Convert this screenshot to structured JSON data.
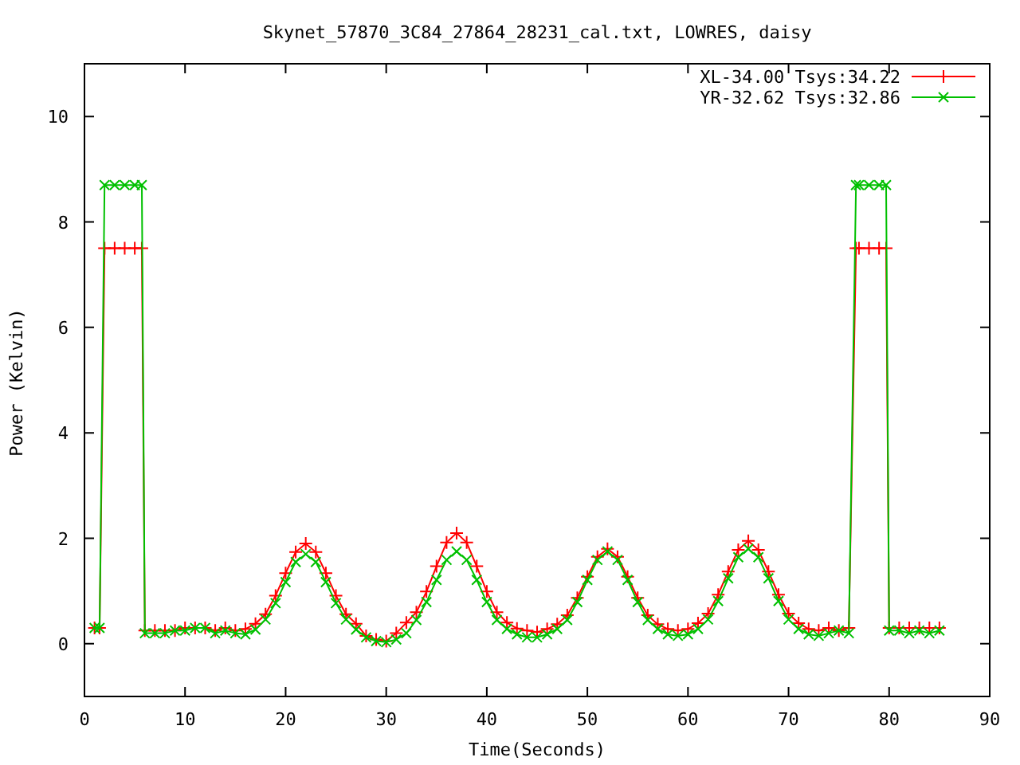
{
  "plot": {
    "chart_data": {
      "type": "line",
      "title": "Skynet_57870_3C84_27864_28231_cal.txt, LOWRES, daisy",
      "xlabel": "Time(Seconds)",
      "ylabel": "Power (Kelvin)",
      "x": [
        1,
        1.5,
        2,
        3,
        4,
        5,
        5.7,
        6,
        7,
        8,
        9,
        10,
        11,
        12,
        13,
        14,
        15,
        16,
        17,
        18,
        19,
        20,
        21,
        22,
        23,
        24,
        25,
        26,
        27,
        28,
        29,
        30,
        31,
        32,
        33,
        34,
        35,
        36,
        37,
        38,
        39,
        40,
        41,
        42,
        43,
        44,
        45,
        46,
        47,
        48,
        49,
        50,
        51,
        52,
        53,
        54,
        55,
        56,
        57,
        58,
        59,
        60,
        61,
        62,
        63,
        64,
        65,
        66,
        67,
        68,
        69,
        70,
        71,
        72,
        73,
        74,
        75,
        76,
        76.7,
        77,
        78,
        79,
        79.7,
        80,
        81,
        82,
        83,
        84,
        85
      ],
      "series": [
        {
          "name": "XL-34.00 Tsys:34.22",
          "color": "#ff0000",
          "marker": "plus",
          "values": [
            0.3,
            0.3,
            7.5,
            7.5,
            7.5,
            7.5,
            7.5,
            0.25,
            0.25,
            0.25,
            0.25,
            0.3,
            0.3,
            0.3,
            0.25,
            0.3,
            0.25,
            0.28,
            0.38,
            0.56,
            0.91,
            1.34,
            1.74,
            1.9,
            1.74,
            1.34,
            0.91,
            0.56,
            0.38,
            0.15,
            0.08,
            0.05,
            0.2,
            0.4,
            0.6,
            0.99,
            1.47,
            1.92,
            2.1,
            1.92,
            1.47,
            0.99,
            0.6,
            0.4,
            0.29,
            0.25,
            0.22,
            0.28,
            0.37,
            0.54,
            0.87,
            1.27,
            1.65,
            1.8,
            1.65,
            1.27,
            0.87,
            0.54,
            0.37,
            0.28,
            0.25,
            0.28,
            0.39,
            0.57,
            0.93,
            1.37,
            1.78,
            1.95,
            1.78,
            1.37,
            0.93,
            0.57,
            0.39,
            0.28,
            0.25,
            0.3,
            0.25,
            0.3,
            7.5,
            7.5,
            7.5,
            7.5,
            7.5,
            0.3,
            0.3,
            0.3,
            0.3,
            0.3,
            0.3
          ]
        },
        {
          "name": "YR-32.62 Tsys:32.86",
          "color": "#00c000",
          "marker": "cross",
          "values": [
            0.3,
            0.3,
            8.7,
            8.7,
            8.7,
            8.7,
            8.7,
            0.2,
            0.2,
            0.2,
            0.25,
            0.25,
            0.3,
            0.3,
            0.2,
            0.25,
            0.2,
            0.18,
            0.27,
            0.46,
            0.77,
            1.17,
            1.55,
            1.7,
            1.55,
            1.17,
            0.77,
            0.46,
            0.27,
            0.12,
            0.05,
            0.03,
            0.08,
            0.2,
            0.45,
            0.79,
            1.21,
            1.59,
            1.75,
            1.59,
            1.21,
            0.79,
            0.45,
            0.28,
            0.18,
            0.12,
            0.12,
            0.18,
            0.28,
            0.45,
            0.79,
            1.21,
            1.59,
            1.75,
            1.59,
            1.21,
            0.79,
            0.45,
            0.28,
            0.18,
            0.15,
            0.18,
            0.28,
            0.46,
            0.81,
            1.24,
            1.64,
            1.8,
            1.64,
            1.24,
            0.81,
            0.46,
            0.28,
            0.18,
            0.15,
            0.2,
            0.25,
            0.2,
            8.7,
            8.7,
            8.7,
            8.7,
            8.7,
            0.25,
            0.25,
            0.2,
            0.25,
            0.2,
            0.25
          ]
        }
      ],
      "legend": true,
      "xlim": [
        0,
        90
      ],
      "ylim": [
        -1,
        11
      ],
      "xticks": [
        0,
        10,
        20,
        30,
        40,
        50,
        60,
        70,
        80,
        90
      ],
      "yticks": [
        0,
        2,
        4,
        6,
        8,
        10
      ]
    }
  }
}
